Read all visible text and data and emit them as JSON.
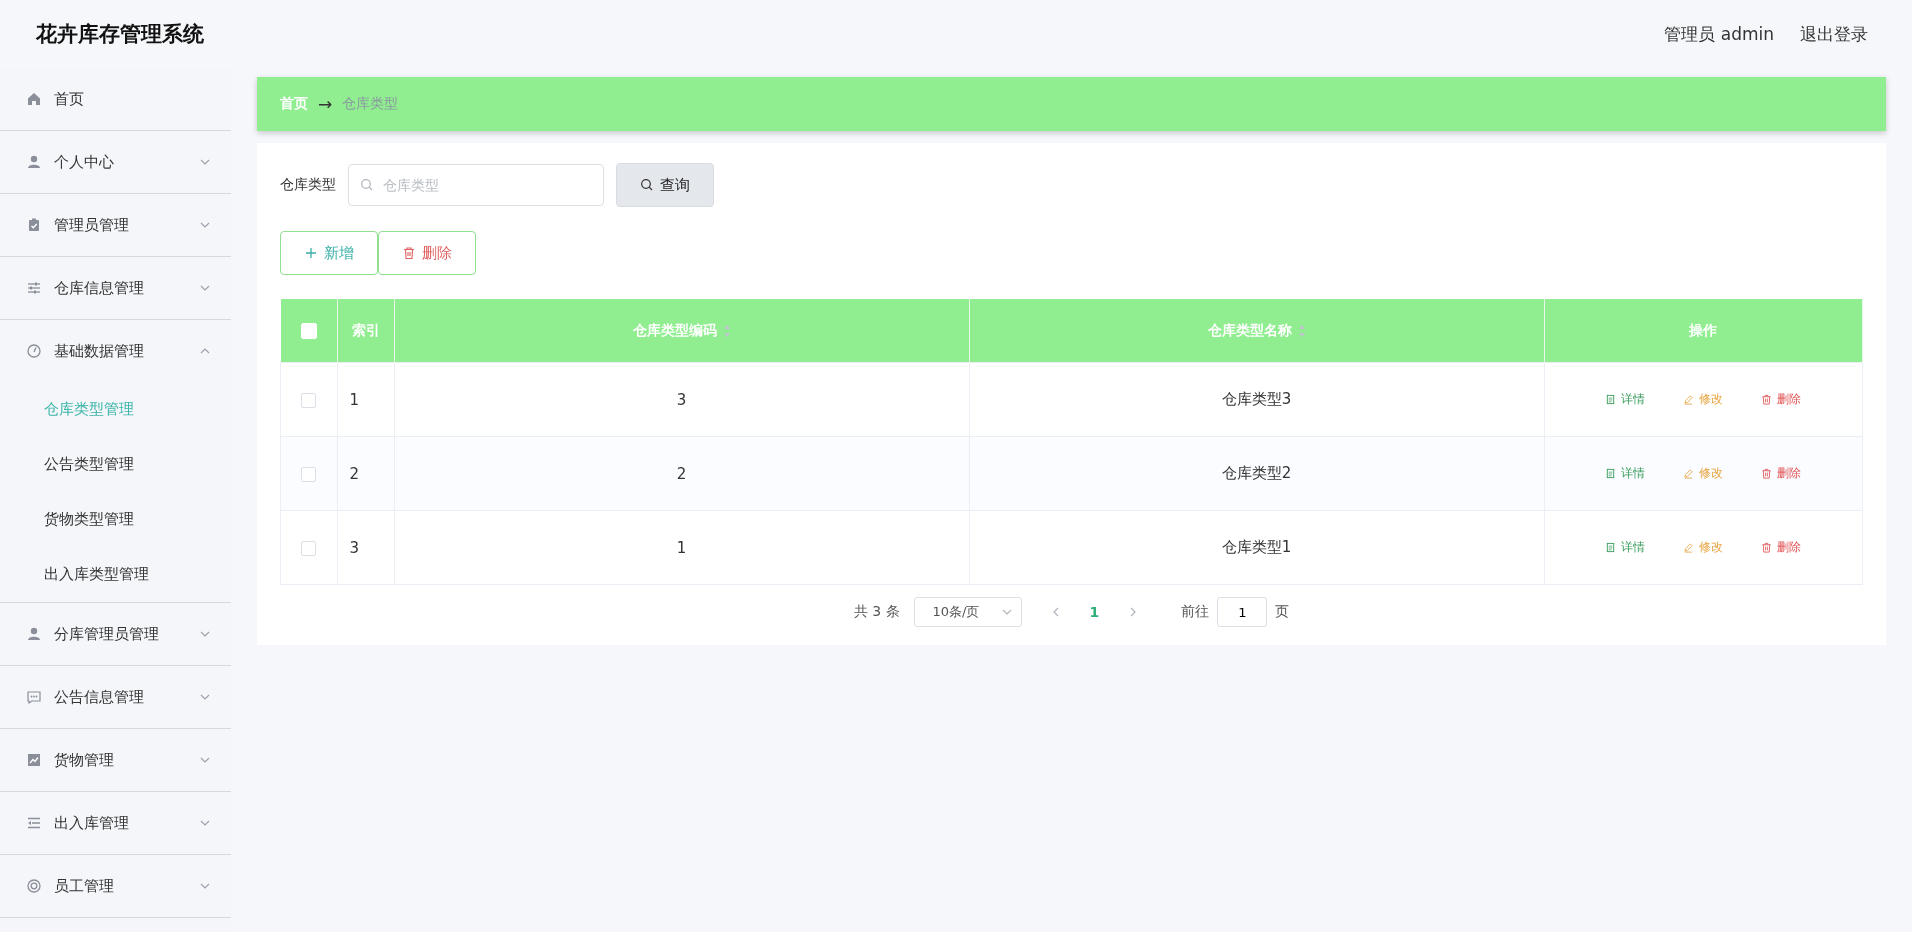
{
  "header": {
    "title": "花卉库存管理系统",
    "user": "管理员 admin",
    "logout": "退出登录"
  },
  "sidebar": {
    "items": [
      {
        "label": "首页",
        "kind": "link"
      },
      {
        "label": "个人中心",
        "kind": "group",
        "expanded": false
      },
      {
        "label": "管理员管理",
        "kind": "group",
        "expanded": false
      },
      {
        "label": "仓库信息管理",
        "kind": "group",
        "expanded": false
      },
      {
        "label": "基础数据管理",
        "kind": "group",
        "expanded": true,
        "children": [
          {
            "label": "仓库类型管理",
            "selected": true
          },
          {
            "label": "公告类型管理",
            "selected": false
          },
          {
            "label": "货物类型管理",
            "selected": false
          },
          {
            "label": "出入库类型管理",
            "selected": false
          }
        ]
      },
      {
        "label": "分库管理员管理",
        "kind": "group",
        "expanded": false
      },
      {
        "label": "公告信息管理",
        "kind": "group",
        "expanded": false
      },
      {
        "label": "货物管理",
        "kind": "group",
        "expanded": false
      },
      {
        "label": "出入库管理",
        "kind": "group",
        "expanded": false
      },
      {
        "label": "员工管理",
        "kind": "group",
        "expanded": false
      }
    ]
  },
  "breadcrumb": {
    "separator": "→",
    "items": [
      "首页",
      "仓库类型"
    ]
  },
  "search": {
    "label": "仓库类型",
    "placeholder": "仓库类型",
    "button": "查询"
  },
  "actions": [
    {
      "label": "新增",
      "kind": "add"
    },
    {
      "label": "删除",
      "kind": "delete"
    }
  ],
  "table": {
    "all_checked": false,
    "columns": [
      {
        "label": "索引",
        "sortable": false
      },
      {
        "label": "仓库类型编码",
        "sortable": true
      },
      {
        "label": "仓库类型名称",
        "sortable": true
      },
      {
        "label": "操作",
        "sortable": false
      }
    ],
    "rows": [
      {
        "checked": false,
        "cells": [
          "1",
          "3",
          "仓库类型3"
        ],
        "actions": [
          {
            "label": "详情",
            "kind": "detail"
          },
          {
            "label": "修改",
            "kind": "edit"
          },
          {
            "label": "删除",
            "kind": "delete"
          }
        ]
      },
      {
        "checked": false,
        "cells": [
          "2",
          "2",
          "仓库类型2"
        ],
        "actions": [
          {
            "label": "详情",
            "kind": "detail"
          },
          {
            "label": "修改",
            "kind": "edit"
          },
          {
            "label": "删除",
            "kind": "delete"
          }
        ]
      },
      {
        "checked": false,
        "cells": [
          "3",
          "1",
          "仓库类型1"
        ],
        "actions": [
          {
            "label": "详情",
            "kind": "detail"
          },
          {
            "label": "修改",
            "kind": "edit"
          },
          {
            "label": "删除",
            "kind": "delete"
          }
        ]
      }
    ]
  },
  "pagination": {
    "total": "共 3 条",
    "page_size": "10条/页",
    "pages": [
      {
        "label": "1",
        "selected": true
      }
    ],
    "goto_label": "前往",
    "goto_value": "1",
    "goto_suffix": "页"
  }
}
